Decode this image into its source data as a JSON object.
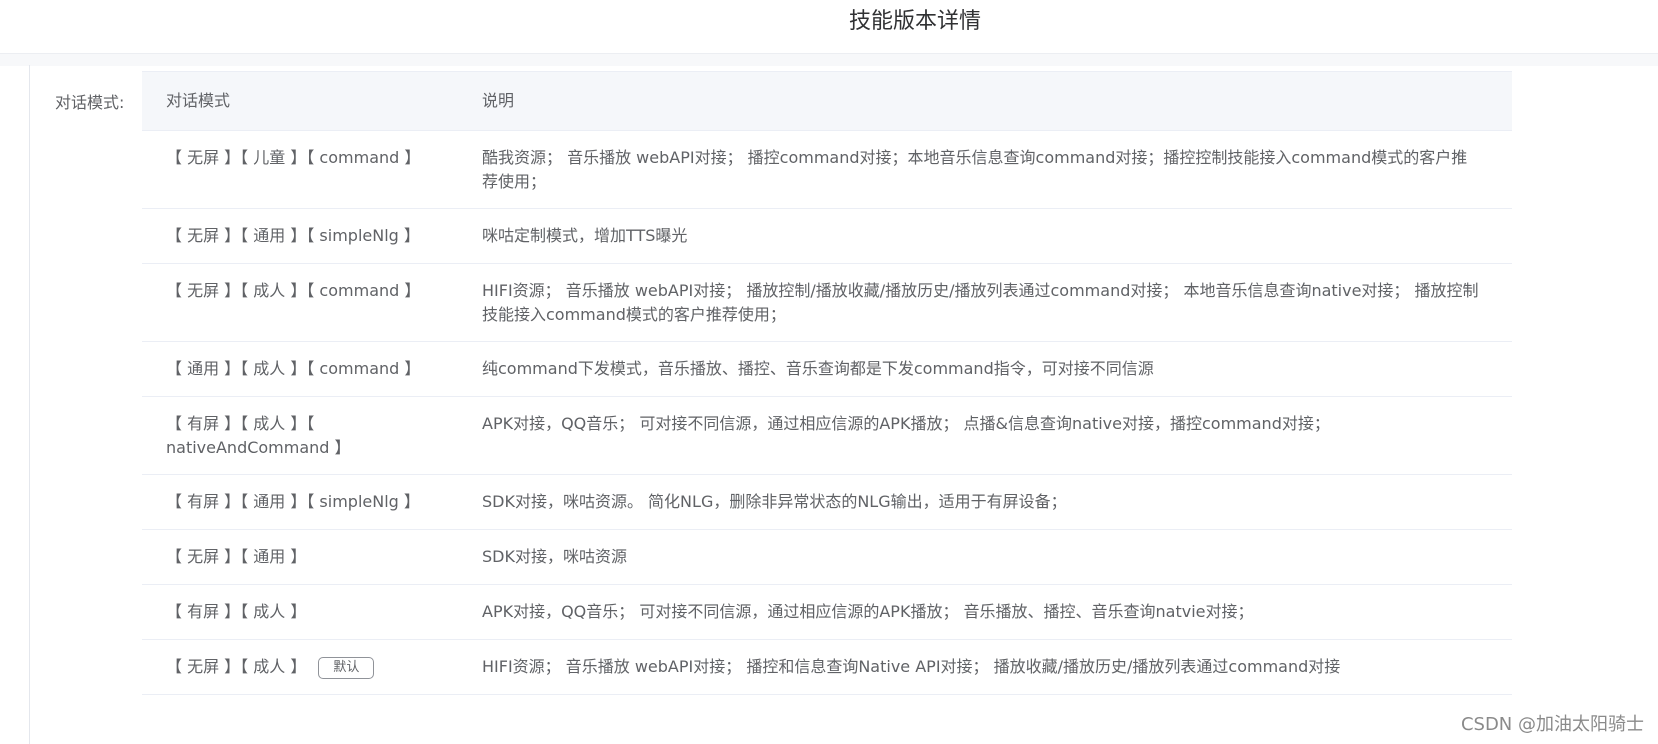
{
  "page": {
    "title": "技能版本详情"
  },
  "form": {
    "label": "对话模式:"
  },
  "table": {
    "headers": [
      "对话模式",
      "说明"
    ],
    "rows": [
      {
        "mode": "【 无屏 】【 儿童 】【 command 】",
        "desc": "酷我资源； 音乐播放 webAPI对接； 播控command对接；本地音乐信息查询command对接；播控控制技能接入command模式的客户推荐使用；",
        "badge": ""
      },
      {
        "mode": "【 无屏 】【 通用 】【 simpleNlg 】",
        "desc": "咪咕定制模式，增加TTS曝光",
        "badge": ""
      },
      {
        "mode": "【 无屏 】【 成人 】【 command 】",
        "desc": "HIFI资源； 音乐播放 webAPI对接； 播放控制/播放收藏/播放历史/播放列表通过command对接； 本地音乐信息查询native对接； 播放控制技能接入command模式的客户推荐使用；",
        "badge": ""
      },
      {
        "mode": "【 通用 】【 成人 】【 command 】",
        "desc": "纯command下发模式，音乐播放、播控、音乐查询都是下发command指令，可对接不同信源",
        "badge": ""
      },
      {
        "mode": "【 有屏 】【 成人 】【 nativeAndCommand 】",
        "desc": "APK对接，QQ音乐； 可对接不同信源，通过相应信源的APK播放； 点播&信息查询native对接，播控command对接；",
        "badge": ""
      },
      {
        "mode": "【 有屏 】【 通用 】【 simpleNlg 】",
        "desc": "SDK对接，咪咕资源。 简化NLG，删除非异常状态的NLG输出，适用于有屏设备；",
        "badge": ""
      },
      {
        "mode": "【 无屏 】【 通用 】",
        "desc": "SDK对接，咪咕资源",
        "badge": ""
      },
      {
        "mode": "【 有屏 】【 成人 】",
        "desc": "APK对接，QQ音乐； 可对接不同信源，通过相应信源的APK播放； 音乐播放、播控、音乐查询natvie对接；",
        "badge": ""
      },
      {
        "mode": "【 无屏 】【 成人 】",
        "desc": "HIFI资源； 音乐播放 webAPI对接； 播控和信息查询Native API对接； 播放收藏/播放历史/播放列表通过command对接",
        "badge": "默认"
      }
    ]
  },
  "watermark": {
    "text": "CSDN @加油太阳骑士"
  }
}
